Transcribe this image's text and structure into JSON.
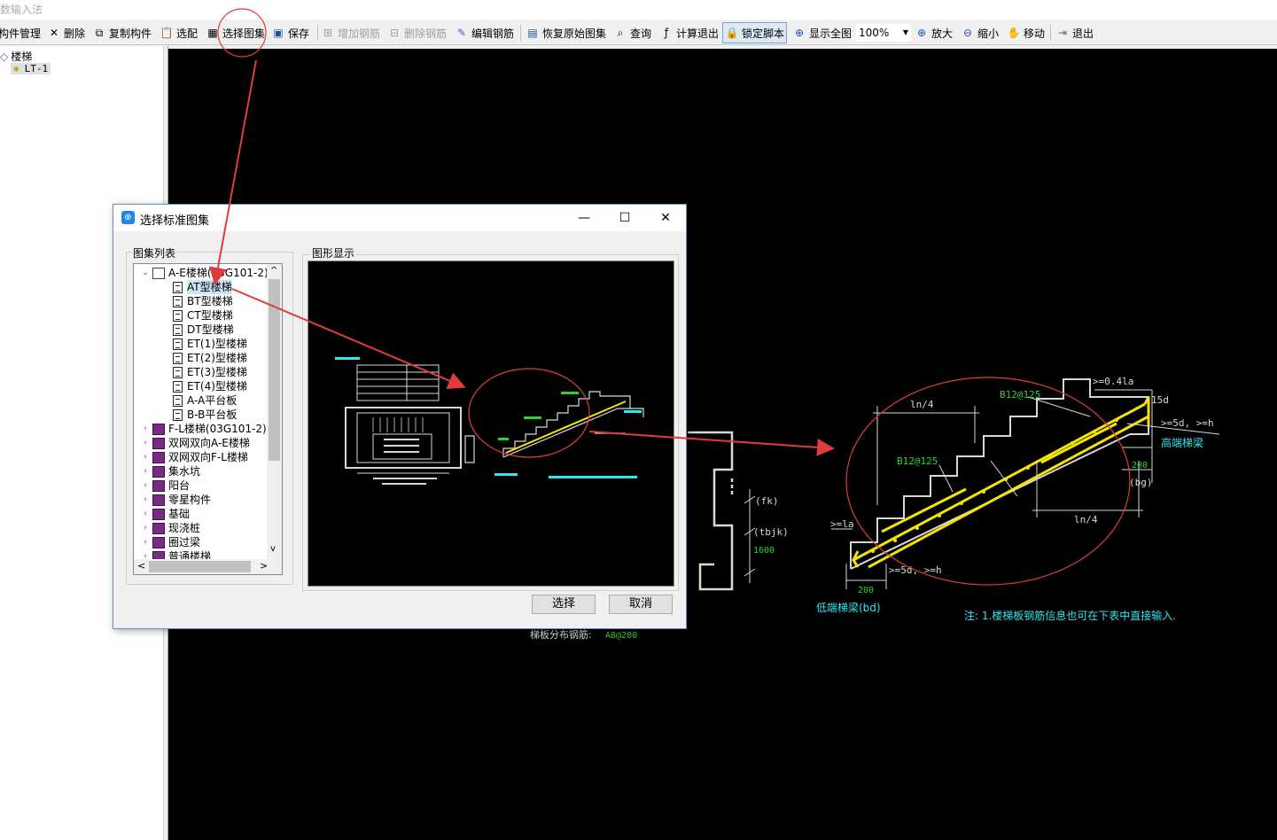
{
  "window": {
    "title": "数输入法"
  },
  "toolbar": {
    "items": [
      {
        "label": "构件管理"
      },
      {
        "label": "删除"
      },
      {
        "label": "复制构件"
      },
      {
        "label": "选配"
      },
      {
        "label": "选择图集"
      },
      {
        "label": "保存"
      },
      {
        "label": "增加钢筋"
      },
      {
        "label": "删除钢筋"
      },
      {
        "label": "编辑钢筋"
      },
      {
        "label": "恢复原始图集"
      },
      {
        "label": "查询"
      },
      {
        "label": "计算退出"
      },
      {
        "label": "锁定脚本"
      },
      {
        "label": "显示全图"
      },
      {
        "label": "放大"
      },
      {
        "label": "缩小"
      },
      {
        "label": "移动"
      },
      {
        "label": "退出"
      }
    ],
    "zoom_value": "100%"
  },
  "left_tree": {
    "root": "楼梯",
    "child": "LT-1"
  },
  "canvas": {
    "texts": {
      "fk": "(fk)",
      "tbjk": "(tbjk)",
      "h1600": "1600",
      "dist_rebar_label": "梯板分布钢筋:",
      "dist_rebar_value": "A8@200",
      "ln4a": "ln/4",
      "b12a": "B12@125",
      "b12b": "B12@125",
      "ge04la": ">=0.4la",
      "d15": "15d",
      "ge5d_h": ">=5d, >=h",
      "high_beam": "高端梯梁",
      "v200a": "200",
      "bg": "(bg)",
      "ln4b": "ln/4",
      "gela": ">=la",
      "ge5d_h2": ">=5d, >=h",
      "v200b": "200",
      "low_beam": "低端梯梁(bd)",
      "note": "注: 1.楼梯板钢筋信息也可在下表中直接输入."
    }
  },
  "dialog": {
    "title": "选择标准图集",
    "list_label": "图集列表",
    "preview_label": "图形显示",
    "tree": [
      {
        "label": "A-E楼梯(03G101-2)",
        "type": "open-book",
        "expand": "v"
      },
      {
        "label": "AT型楼梯",
        "type": "doc",
        "selected": true
      },
      {
        "label": "BT型楼梯",
        "type": "doc"
      },
      {
        "label": "CT型楼梯",
        "type": "doc"
      },
      {
        "label": "DT型楼梯",
        "type": "doc"
      },
      {
        "label": "ET(1)型楼梯",
        "type": "doc"
      },
      {
        "label": "ET(2)型楼梯",
        "type": "doc"
      },
      {
        "label": "ET(3)型楼梯",
        "type": "doc"
      },
      {
        "label": "ET(4)型楼梯",
        "type": "doc"
      },
      {
        "label": "A-A平台板",
        "type": "doc"
      },
      {
        "label": "B-B平台板",
        "type": "doc"
      },
      {
        "label": "F-L楼梯(03G101-2)",
        "type": "book",
        "expand": ">"
      },
      {
        "label": "双网双向A-E楼梯",
        "type": "book",
        "expand": ">"
      },
      {
        "label": "双网双向F-L楼梯",
        "type": "book",
        "expand": ">"
      },
      {
        "label": "集水坑",
        "type": "book",
        "expand": ">"
      },
      {
        "label": "阳台",
        "type": "book",
        "expand": ">"
      },
      {
        "label": "零星构件",
        "type": "book",
        "expand": ">"
      },
      {
        "label": "基础",
        "type": "book",
        "expand": ">"
      },
      {
        "label": "现浇桩",
        "type": "book",
        "expand": ">"
      },
      {
        "label": "圈过梁",
        "type": "book",
        "expand": ">"
      },
      {
        "label": "普通楼梯",
        "type": "book",
        "expand": ">"
      }
    ],
    "buttons": {
      "select": "选择",
      "cancel": "取消"
    }
  },
  "colors": {
    "canvas_bg": "#000000",
    "cad_white": "#d8d8d8",
    "cad_yellow": "#f5e400",
    "cad_green": "#2fd12f",
    "cad_cyan": "#2ee6f0",
    "annotation_red": "#e03c3c"
  }
}
